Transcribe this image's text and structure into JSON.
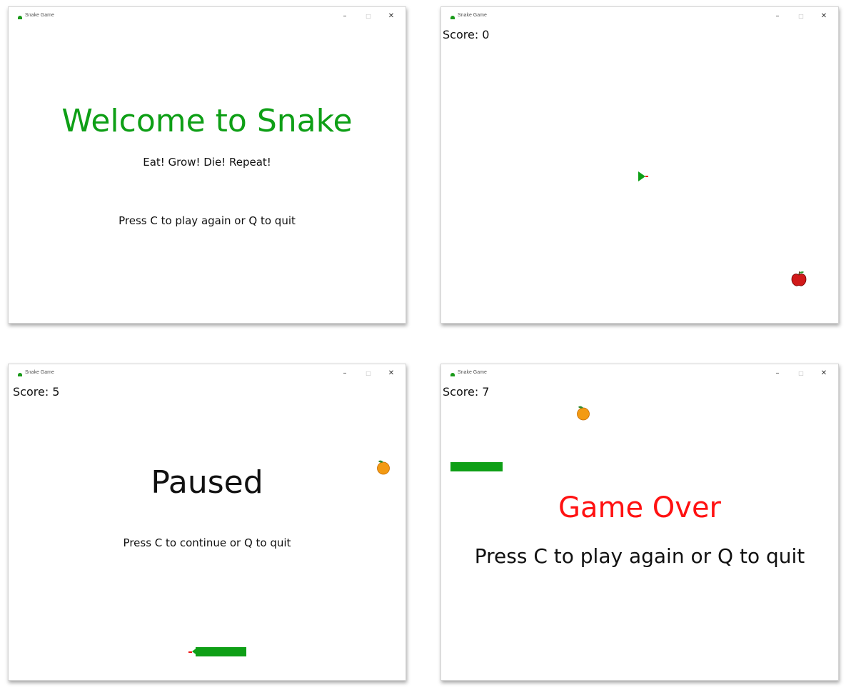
{
  "windows": [
    {
      "title": "Snake Game",
      "heading": "Welcome to Snake",
      "subtitle": "Eat! Grow! Die! Repeat!",
      "message": "Press C to play again or Q to quit"
    },
    {
      "title": "Snake Game",
      "score_text": "Score: 0",
      "fruit": "apple-icon"
    },
    {
      "title": "Snake Game",
      "score_text": "Score: 5",
      "heading": "Paused",
      "message": "Press C to continue or Q to quit",
      "fruit": "orange-icon"
    },
    {
      "title": "Snake Game",
      "score_text": "Score: 7",
      "heading": "Game Over",
      "message": "Press C to play again or Q to quit",
      "fruit": "orange-icon"
    }
  ],
  "window_controls": {
    "minimize": "–",
    "maximize": "□",
    "close": "✕"
  },
  "colors": {
    "snake": "#0e9f16",
    "welcome_heading": "#0e9f16",
    "game_over_heading": "#ff1111",
    "text": "#111111"
  }
}
